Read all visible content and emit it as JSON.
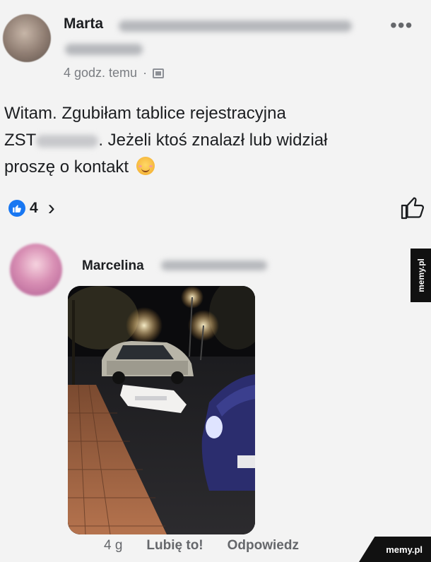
{
  "post": {
    "author": "Marta",
    "time": "4 godz. temu",
    "separator": "·",
    "text_line1": "Witam. Zgubiłam tablice rejestracyjna",
    "text_line2_prefix": "ZST",
    "text_line2_suffix": ". Jeżeli ktoś znalazł lub widział",
    "text_line3": "proszę o kontakt",
    "reaction_count": "4",
    "reaction_icon": "like-icon",
    "more_icon": "more-options-icon"
  },
  "comment": {
    "author": "Marcelina",
    "time": "4 g",
    "like_label": "Lubię to!",
    "reply_label": "Odpowiedz"
  },
  "watermark": {
    "side": "memy.pl",
    "corner": "memy.pl"
  },
  "colors": {
    "background": "#f3f3f3",
    "reaction_blue": "#1877f2",
    "meta_gray": "#65676b",
    "watermark_bg": "#111111"
  }
}
